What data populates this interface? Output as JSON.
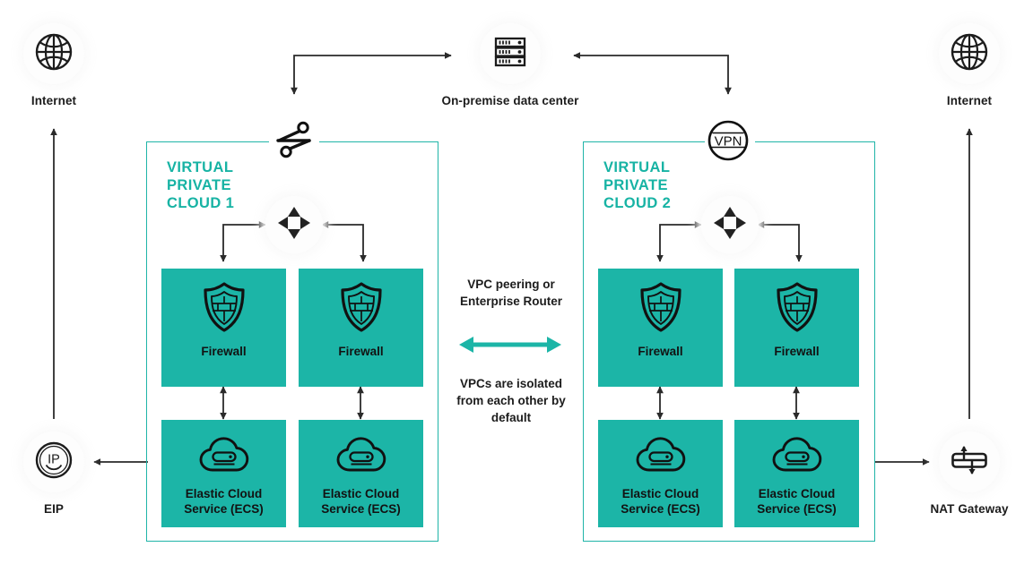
{
  "diagram": {
    "title": "Virtual Private Cloud network architecture",
    "colors": {
      "teal": "#1cb5a7",
      "teal_border": "#20b5a8",
      "teal_title": "#17b3a4",
      "arrow_dark": "#2a2a2a",
      "background": "#ffffff"
    }
  },
  "left_internet": {
    "label": "Internet",
    "icon": "globe-icon"
  },
  "right_internet": {
    "label": "Internet",
    "icon": "globe-icon"
  },
  "on_premise": {
    "label": "On-premise\ndata center",
    "icon": "server-rack-icon"
  },
  "eip": {
    "label": "EIP",
    "icon": "ip-circle-icon",
    "icon_text": "IP"
  },
  "nat_gateway": {
    "label": "NAT Gateway",
    "icon": "nat-gateway-icon"
  },
  "direct_connect": {
    "icon": "direct-connect-switch-icon",
    "label": ""
  },
  "vpn": {
    "icon": "vpn-circle-icon",
    "icon_text": "VPN"
  },
  "vpc1": {
    "title": "VIRTUAL\nPRIVATE\nCLOUD 1",
    "router": {
      "icon": "router-icon"
    },
    "tiles": [
      {
        "label": "Firewall",
        "icon": "shield-firewall-icon",
        "type": "firewall"
      },
      {
        "label": "Firewall",
        "icon": "shield-firewall-icon",
        "type": "firewall"
      },
      {
        "label": "Elastic Cloud\nService (ECS)",
        "icon": "cloud-server-icon",
        "type": "ecs"
      },
      {
        "label": "Elastic Cloud\nService (ECS)",
        "icon": "cloud-server-icon",
        "type": "ecs"
      }
    ]
  },
  "vpc2": {
    "title": "VIRTUAL\nPRIVATE\nCLOUD 2",
    "router": {
      "icon": "router-icon"
    },
    "tiles": [
      {
        "label": "Firewall",
        "icon": "shield-firewall-icon",
        "type": "firewall"
      },
      {
        "label": "Firewall",
        "icon": "shield-firewall-icon",
        "type": "firewall"
      },
      {
        "label": "Elastic Cloud\nService (ECS)",
        "icon": "cloud-server-icon",
        "type": "ecs"
      },
      {
        "label": "Elastic Cloud\nService (ECS)",
        "icon": "cloud-server-icon",
        "type": "ecs"
      }
    ]
  },
  "center": {
    "top_note": "VPC peering or\nEnterprise Router",
    "bottom_note": "VPCs are isolated\nfrom each other by\ndefault",
    "arrow": {
      "icon": "double-headed-arrow-icon",
      "color": "#1cb5a7"
    }
  }
}
